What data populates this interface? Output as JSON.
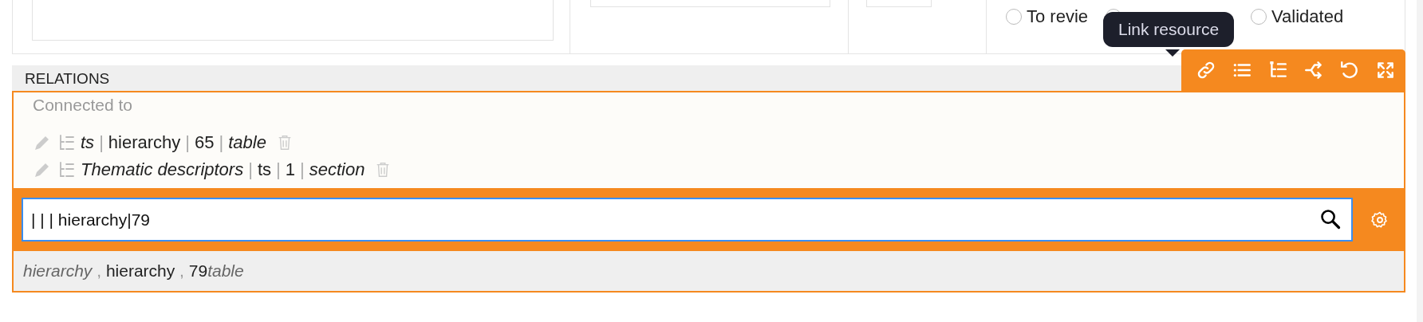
{
  "status_radios": [
    {
      "label": "To revie",
      "selected": false
    },
    {
      "selected": false
    },
    {
      "label": "Validated",
      "selected": false
    }
  ],
  "tooltip": {
    "text": "Link resource"
  },
  "relations": {
    "title": "RELATIONS",
    "toolbar": [
      {
        "kind": "link"
      },
      {
        "kind": "list"
      },
      {
        "kind": "tree"
      },
      {
        "kind": "merge"
      },
      {
        "kind": "undo"
      },
      {
        "kind": "expand"
      }
    ],
    "connected_label": "Connected to",
    "items": [
      {
        "parts": [
          {
            "kind": "name",
            "text": "ts"
          },
          {
            "kind": "sep",
            "text": "|"
          },
          {
            "kind": "value",
            "text": "hierarchy"
          },
          {
            "kind": "sep",
            "text": "|"
          },
          {
            "kind": "value",
            "text": "65"
          },
          {
            "kind": "sep",
            "text": "|"
          },
          {
            "kind": "name",
            "text": "table"
          }
        ]
      },
      {
        "parts": [
          {
            "kind": "name",
            "text": "Thematic descriptors"
          },
          {
            "kind": "sep",
            "text": "|"
          },
          {
            "kind": "value",
            "text": "ts"
          },
          {
            "kind": "sep",
            "text": "|"
          },
          {
            "kind": "value",
            "text": "1"
          },
          {
            "kind": "sep",
            "text": "|"
          },
          {
            "kind": "name",
            "text": "section"
          }
        ]
      }
    ],
    "search": {
      "value": "| | | hierarchy|79"
    },
    "suggestion": [
      {
        "text": "hierarchy",
        "kind": "name"
      },
      {
        "text": " , ",
        "kind": "sep"
      },
      {
        "text": "hierarchy",
        "kind": "value"
      },
      {
        "text": " , ",
        "kind": "sep"
      },
      {
        "text": "79",
        "kind": "value"
      },
      {
        "text": "table",
        "kind": "name"
      }
    ]
  }
}
